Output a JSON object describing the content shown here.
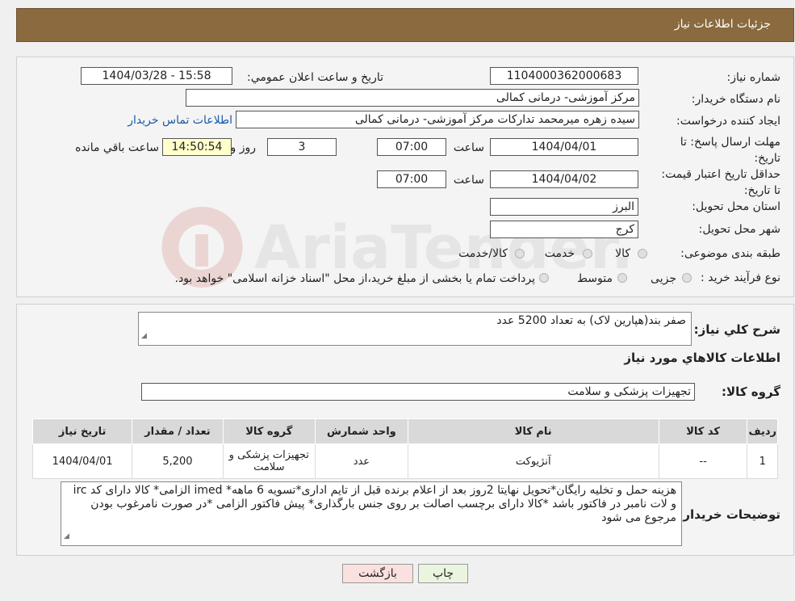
{
  "header": {
    "title": "جزئیات اطلاعات نیاز"
  },
  "details": {
    "need_number_label": "شماره نیاز:",
    "need_number": "1104000362000683",
    "announce_label": "تاریخ و ساعت اعلان عمومي:",
    "announce_value": "1404/03/28 - 15:58",
    "buyer_org_label": "نام دستگاه خریدار:",
    "buyer_org": "مرکز آموزشی- درمانی کمالی",
    "creator_label": "ایجاد کننده درخواست:",
    "creator": "سیده زهره میرمحمد تدارکات مرکز آموزشی- درمانی کمالی",
    "contact_link": "اطلاعات تماس خریدار",
    "deadline_label": "مهلت ارسال پاسخ: تا تاریخ:",
    "deadline_date": "1404/04/01",
    "time_label": "ساعت",
    "deadline_time": "07:00",
    "days_value": "3",
    "days_label": "روز و",
    "remaining_time": "14:50:54",
    "remaining_label": "ساعت باقي مانده",
    "validity_label": "حداقل تاریخ اعتبار قیمت: تا تاریخ:",
    "validity_date": "1404/04/02",
    "validity_time": "07:00",
    "province_label": "استان محل تحویل:",
    "province": "البرز",
    "city_label": "شهر محل تحویل:",
    "city": "کرج",
    "category_label": "طبقه بندی موضوعی:",
    "category_options": [
      "کالا",
      "خدمت",
      "کالا/خدمت"
    ],
    "process_label": "نوع فرآیند خرید :",
    "process_options": [
      "جزیی",
      "متوسط"
    ],
    "process_note": "پرداخت تمام یا بخشی از مبلغ خرید،از محل \"اسناد خزانه اسلامی\" خواهد بود."
  },
  "summary": {
    "description_label": "شرح کلي نیاز:",
    "description": "صفر بند(هپارین لاک) به تعداد 5200 عدد",
    "items_info_title": "اطلاعات کالاهاي مورد نیاز",
    "goods_group_label": "گروه کالا:",
    "goods_group": "تجهیزات پزشکی و سلامت"
  },
  "table": {
    "headers": [
      "ردیف",
      "کد کالا",
      "نام کالا",
      "واحد شمارش",
      "گروه کالا",
      "تعداد / مقدار",
      "تاریخ نیاز"
    ],
    "rows": [
      [
        "1",
        "--",
        "آنژیوکت",
        "عدد",
        "تجهیزات پزشکی و سلامت",
        "5,200",
        "1404/04/01"
      ]
    ]
  },
  "buyer_notes": {
    "label": "توضیحات خریدار:",
    "text": "هزینه حمل و تخلیه رایگان*تحویل نهایتا 2روز بعد از اعلام برنده قبل از تایم اداری*تسویه 6 ماهه* imed الزامی* کالا دارای کد irc و لات نامبر در فاکتور باشد *کالا دارای برچسب اصالت بر روی جنس بارگذاری* پیش فاکتور الزامی *در صورت نامرغوب بودن مرجوع می شود"
  },
  "buttons": {
    "print": "چاپ",
    "back": "بازگشت"
  },
  "watermark": {
    "text": "AriaTender.neT"
  },
  "colors": {
    "header_bg": "#8a6a3e",
    "remaining_bg": "#ffffcc",
    "print_bg": "#eaf5e0",
    "back_bg": "#fbe0e0",
    "link": "#1a5aa8"
  }
}
